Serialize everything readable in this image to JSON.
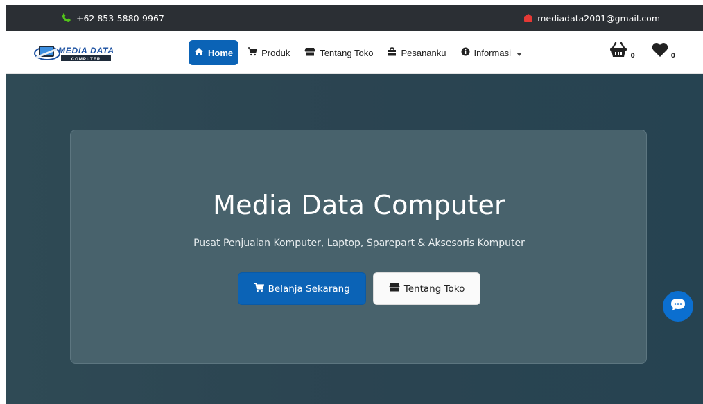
{
  "topbar": {
    "phone": "+62 853-5880-9967",
    "email": "mediadata2001@gmail.com"
  },
  "brand": {
    "logo_text": "MEDIA DATA",
    "logo_subtext": "COMPUTER"
  },
  "nav": {
    "items": [
      {
        "label": "Home",
        "icon": "home-icon",
        "active": true
      },
      {
        "label": "Produk",
        "icon": "cart-icon"
      },
      {
        "label": "Tentang Toko",
        "icon": "store-icon"
      },
      {
        "label": "Pesananku",
        "icon": "bag-icon"
      },
      {
        "label": "Informasi",
        "icon": "info-icon",
        "dropdown": true
      }
    ]
  },
  "counters": {
    "basket_count": "0",
    "wishlist_count": "0"
  },
  "hero": {
    "title": "Media Data Computer",
    "subtitle": "Pusat Penjualan Komputer, Laptop, Sparepart & Aksesoris Komputer",
    "primary_button": "Belanja Sekarang",
    "secondary_button": "Tentang Toko"
  },
  "colors": {
    "accent": "#0b63b6",
    "topbar": "#2b2f34",
    "hero_bg": "#2c4550",
    "card_bg": "#48626c",
    "phone_icon": "#52c41a",
    "mail_icon": "#e53935",
    "chat_button": "#0b6fd0"
  }
}
